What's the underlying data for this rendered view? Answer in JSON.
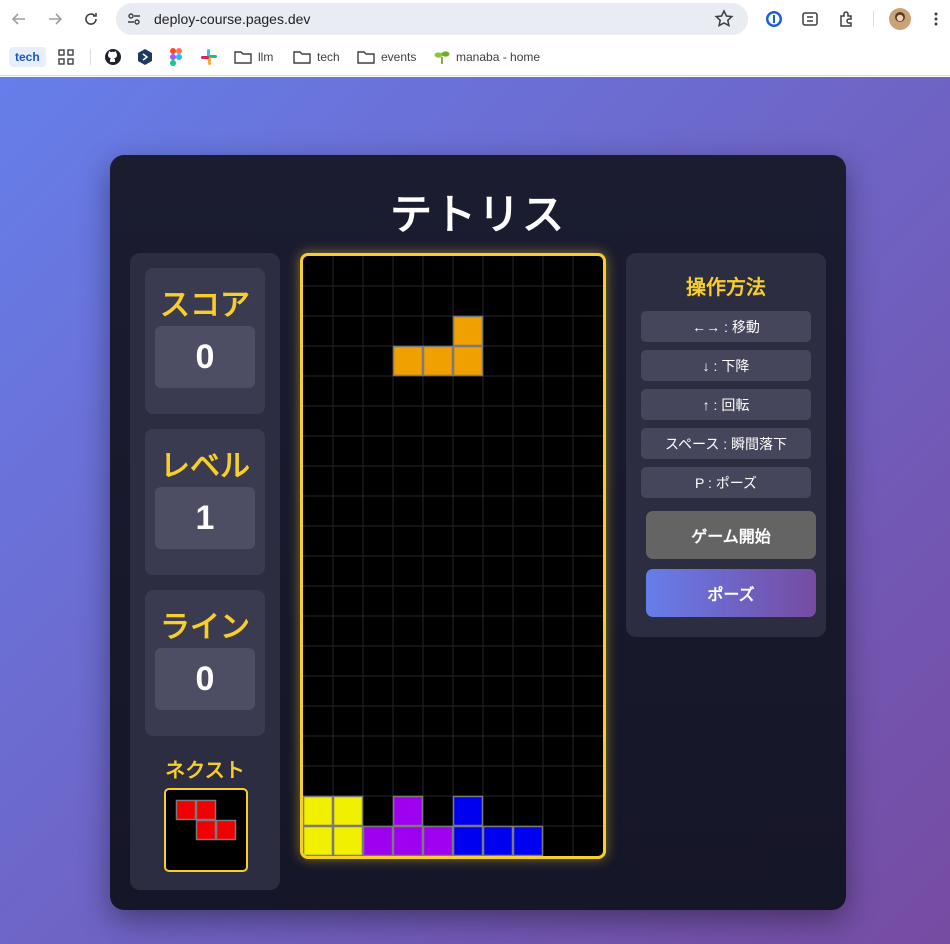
{
  "browser": {
    "url": "deploy-course.pages.dev",
    "bookmarks": {
      "tech_chip": "tech",
      "folders": [
        "llm",
        "tech",
        "events"
      ],
      "manaba": "manaba - home"
    }
  },
  "game": {
    "title": "テトリス",
    "stats": [
      {
        "label": "スコア",
        "value": "0"
      },
      {
        "label": "レベル",
        "value": "1"
      },
      {
        "label": "ライン",
        "value": "0"
      }
    ],
    "next_label": "ネクスト",
    "controls_title": "操作方法",
    "controls": [
      "←→ : 移動",
      "↓ : 下降",
      "↑ : 回転",
      "スペース : 瞬間落下",
      "P : ポーズ"
    ],
    "start_button": "ゲーム開始",
    "pause_button": "ポーズ",
    "board": {
      "cols": 10,
      "rows": 20,
      "active_piece": {
        "color": "#f0a000",
        "cells": [
          [
            5,
            2
          ],
          [
            3,
            3
          ],
          [
            4,
            3
          ],
          [
            5,
            3
          ]
        ]
      },
      "locked": [
        {
          "color": "#f0f000",
          "cells": [
            [
              0,
              18
            ],
            [
              1,
              18
            ],
            [
              0,
              19
            ],
            [
              1,
              19
            ]
          ]
        },
        {
          "color": "#a000f0",
          "cells": [
            [
              3,
              18
            ],
            [
              2,
              19
            ],
            [
              3,
              19
            ],
            [
              4,
              19
            ]
          ]
        },
        {
          "color": "#0000f0",
          "cells": [
            [
              5,
              18
            ],
            [
              5,
              19
            ],
            [
              6,
              19
            ],
            [
              7,
              19
            ]
          ]
        }
      ]
    },
    "next_piece": {
      "color": "#f00000",
      "cells": [
        [
          0,
          0
        ],
        [
          1,
          0
        ],
        [
          1,
          1
        ],
        [
          2,
          1
        ]
      ]
    }
  }
}
